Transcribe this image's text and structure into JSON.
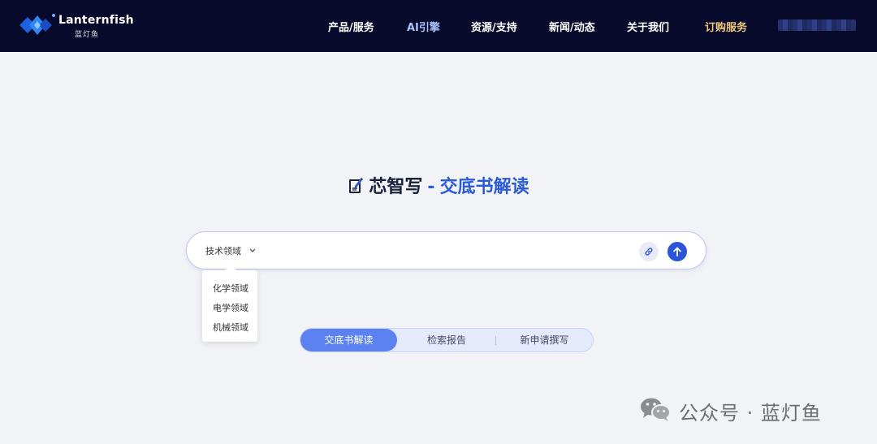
{
  "header": {
    "logo_en": "Lanternfish",
    "logo_cn": "蓝灯鱼",
    "nav": [
      {
        "label": "产品/服务"
      },
      {
        "label": "AI引擎"
      },
      {
        "label": "资源/支持"
      },
      {
        "label": "新闻/动态"
      },
      {
        "label": "关于我们"
      },
      {
        "label": "订购服务"
      }
    ],
    "user_icon": "blurred-user-info"
  },
  "main": {
    "title_part1": "芯智写",
    "title_sep": "-",
    "title_part2": "交底书解读",
    "title_icon": "notebook-pen-icon",
    "search": {
      "domain_label": "技术领域",
      "input_value": "",
      "input_placeholder": "",
      "link_icon": "link-icon",
      "send_icon": "arrow-up-icon"
    },
    "dropdown_options": [
      "化学领域",
      "电学领域",
      "机械领域"
    ],
    "tabs": [
      {
        "label": "交底书解读",
        "active": true
      },
      {
        "label": "检索报告",
        "active": false
      },
      {
        "label": "新申请撰写",
        "active": false
      }
    ]
  },
  "watermark": {
    "text": "公众号 · 蓝灯鱼",
    "icon": "wechat-icon"
  },
  "colors": {
    "header_bg": "#070a2a",
    "accent_blue": "#2a55d8",
    "tab_active": "#5b82f0",
    "subscribe_gold": "#f1c87a",
    "page_bg": "#f2f3f7"
  }
}
